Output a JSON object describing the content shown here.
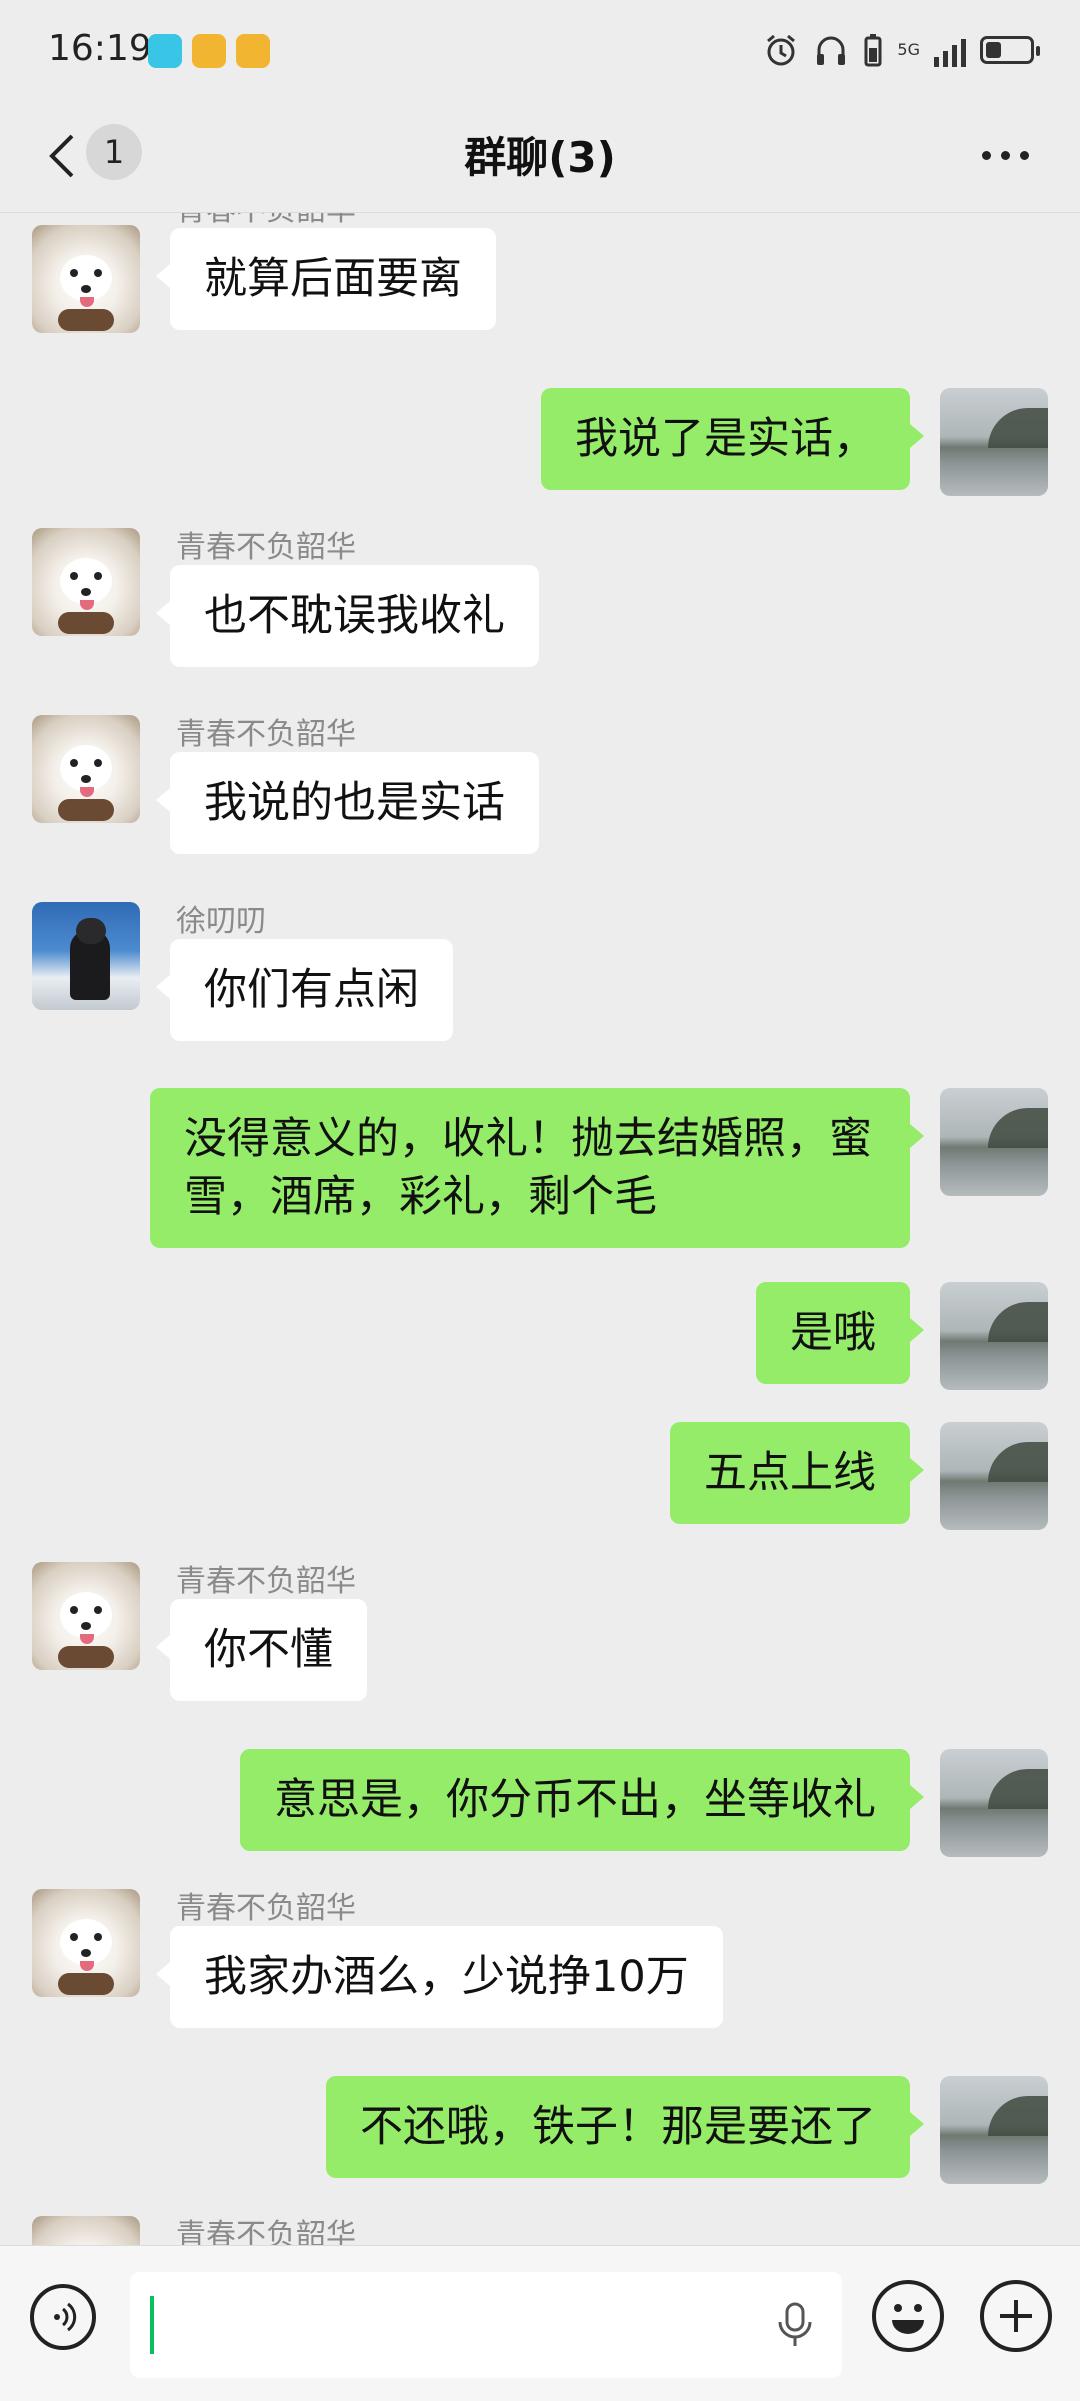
{
  "status_bar": {
    "time": "16:19",
    "network": "5G",
    "battery_level": 0.35,
    "icons": [
      "reader-app-icon",
      "notes-app-icon",
      "notes-app-icon",
      "alarm-icon",
      "headphones-icon",
      "battery-saver-icon",
      "signal-icon",
      "battery-icon"
    ]
  },
  "header": {
    "unread_count": "1",
    "title": "群聊(3)"
  },
  "messages": [
    {
      "sender": "青春不负韶华",
      "text": "就算后面要离",
      "direction": "in",
      "avatar": "dog"
    },
    {
      "sender": "",
      "text": "我说了是实话，",
      "direction": "out",
      "avatar": "lake"
    },
    {
      "sender": "青春不负韶华",
      "text": "也不耽误我收礼",
      "direction": "in",
      "avatar": "dog"
    },
    {
      "sender": "青春不负韶华",
      "text": "我说的也是实话",
      "direction": "in",
      "avatar": "dog"
    },
    {
      "sender": "徐叨叨",
      "text": "你们有点闲",
      "direction": "in",
      "avatar": "skier"
    },
    {
      "sender": "",
      "text": "没得意义的，收礼！抛去结婚照，蜜雪，酒席，彩礼，剩个毛",
      "direction": "out",
      "avatar": "lake"
    },
    {
      "sender": "",
      "text": "是哦",
      "direction": "out",
      "avatar": "lake"
    },
    {
      "sender": "",
      "text": "五点上线",
      "direction": "out",
      "avatar": "lake"
    },
    {
      "sender": "青春不负韶华",
      "text": "你不懂",
      "direction": "in",
      "avatar": "dog"
    },
    {
      "sender": "",
      "text": "意思是，你分币不出，坐等收礼",
      "direction": "out",
      "avatar": "lake"
    },
    {
      "sender": "青春不负韶华",
      "text": "我家办酒么，少说挣10万",
      "direction": "in",
      "avatar": "dog"
    },
    {
      "sender": "",
      "text": "不还哦，铁子！那是要还了",
      "direction": "out",
      "avatar": "lake"
    },
    {
      "sender": "青春不负韶华",
      "text": "",
      "direction": "in",
      "avatar": "dog"
    }
  ],
  "input_bar": {
    "voice_icon": "voice-toggle-icon",
    "mic_icon": "microphone-icon",
    "emoji_icon": "emoji-icon",
    "plus_icon": "plus-icon"
  },
  "colors": {
    "background": "#ededed",
    "outgoing_bubble": "#95ec69",
    "incoming_bubble": "#ffffff",
    "cursor": "#07c160"
  }
}
